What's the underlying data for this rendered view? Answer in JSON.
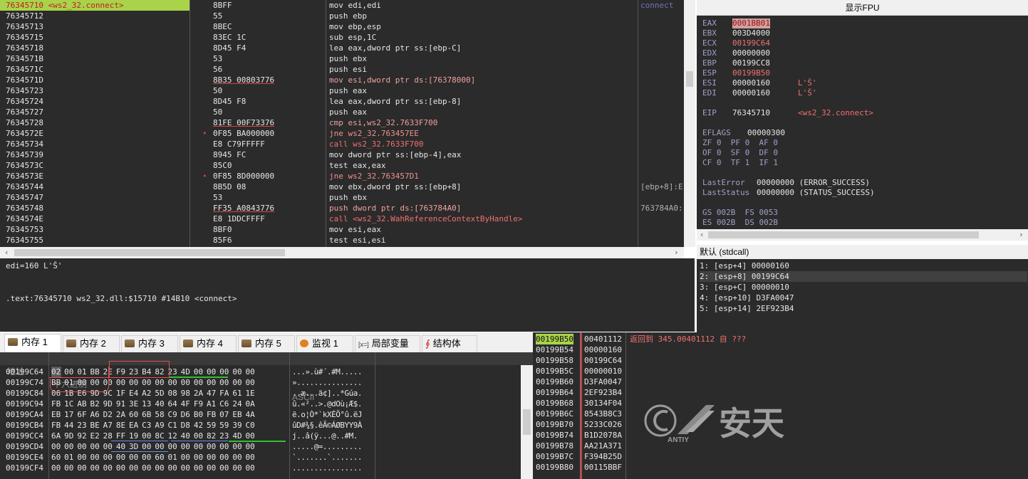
{
  "disasm": {
    "rows": [
      {
        "addr": "76345710 <ws2_32.connect>",
        "mark": "",
        "bytes": "8BFF",
        "instr": "mov edi,edi",
        "cmt": "connect",
        "hl": true
      },
      {
        "addr": "76345712",
        "mark": "",
        "bytes": "55",
        "instr": "push ebp",
        "cmt": ""
      },
      {
        "addr": "76345713",
        "mark": "",
        "bytes": "8BEC",
        "instr": "mov ebp,esp",
        "cmt": ""
      },
      {
        "addr": "76345715",
        "mark": "",
        "bytes": "83EC 1C",
        "instr": "sub esp,1C",
        "cmt": ""
      },
      {
        "addr": "76345718",
        "mark": "",
        "bytes": "8D45 F4",
        "instr": "lea eax,dword ptr ss:[ebp-C]",
        "cmt": ""
      },
      {
        "addr": "7634571B",
        "mark": "",
        "bytes": "53",
        "instr": "push ebx",
        "cmt": ""
      },
      {
        "addr": "7634571C",
        "mark": "",
        "bytes": "56",
        "instr": "push esi",
        "cmt": ""
      },
      {
        "addr": "7634571D",
        "mark": "",
        "bytes": "8B35 00803776",
        "instr": "mov esi,dword ptr ds:[76378000]",
        "cmt": ""
      },
      {
        "addr": "76345723",
        "mark": "",
        "bytes": "50",
        "instr": "push eax",
        "cmt": ""
      },
      {
        "addr": "76345724",
        "mark": "",
        "bytes": "8D45 F8",
        "instr": "lea eax,dword ptr ss:[ebp-8]",
        "cmt": ""
      },
      {
        "addr": "76345727",
        "mark": "",
        "bytes": "50",
        "instr": "push eax",
        "cmt": ""
      },
      {
        "addr": "76345728",
        "mark": "",
        "bytes": "81FE 00F73376",
        "instr": "cmp esi,ws2_32.7633F700",
        "cmt": ""
      },
      {
        "addr": "7634572E",
        "mark": "•",
        "bytes": "0F85 BA000000",
        "instr": "jne ws2_32.763457EE",
        "cmt": ""
      },
      {
        "addr": "76345734",
        "mark": "",
        "bytes": "E8 C79FFFFF",
        "instr": "call ws2_32.7633F700",
        "cmt": ""
      },
      {
        "addr": "76345739",
        "mark": "",
        "bytes": "8945 FC",
        "instr": "mov dword ptr ss:[ebp-4],eax",
        "cmt": ""
      },
      {
        "addr": "7634573C",
        "mark": "",
        "bytes": "85C0",
        "instr": "test eax,eax",
        "cmt": ""
      },
      {
        "addr": "7634573E",
        "mark": "•",
        "bytes": "0F85 8D000000",
        "instr": "jne ws2_32.763457D1",
        "cmt": ""
      },
      {
        "addr": "76345744",
        "mark": "",
        "bytes": "8B5D 08",
        "instr": "mov ebx,dword ptr ss:[ebp+8]",
        "cmt": "[ebp+8]:E"
      },
      {
        "addr": "76345747",
        "mark": "",
        "bytes": "53",
        "instr": "push ebx",
        "cmt": ""
      },
      {
        "addr": "76345748",
        "mark": "",
        "bytes": "FF35 A0843776",
        "instr": "push dword ptr ds:[763784A0]",
        "cmt": "763784A0:"
      },
      {
        "addr": "7634574E",
        "mark": "",
        "bytes": "E8 1DDCFFFF",
        "instr": "call <ws2_32.WahReferenceContextByHandle>",
        "cmt": ""
      },
      {
        "addr": "76345753",
        "mark": "",
        "bytes": "8BF0",
        "instr": "mov esi,eax",
        "cmt": ""
      },
      {
        "addr": "76345755",
        "mark": "",
        "bytes": "85F6",
        "instr": "test esi,esi",
        "cmt": ""
      }
    ]
  },
  "info": {
    "line1": "edi=160 L'Š'",
    "line2": ".text:76345710 ws2_32.dll:$15710 #14B10 <connect>"
  },
  "registers": {
    "header": "显示FPU",
    "lines": [
      {
        "name": "EAX",
        "val": "0001BB01",
        "extra": "",
        "style": "sel"
      },
      {
        "name": "EBX",
        "val": "003D4000",
        "extra": "",
        "style": ""
      },
      {
        "name": "ECX",
        "val": "00199C64",
        "extra": "",
        "style": "red"
      },
      {
        "name": "EDX",
        "val": "00000000",
        "extra": "",
        "style": ""
      },
      {
        "name": "EBP",
        "val": "00199CC8",
        "extra": "",
        "style": ""
      },
      {
        "name": "ESP",
        "val": "00199B50",
        "extra": "",
        "style": "red"
      },
      {
        "name": "ESI",
        "val": "00000160",
        "extra": "L'Š'",
        "style": ""
      },
      {
        "name": "EDI",
        "val": "00000160",
        "extra": "L'Š'",
        "style": ""
      },
      {
        "name": "",
        "val": "",
        "extra": "",
        "style": ""
      },
      {
        "name": "EIP",
        "val": "76345710",
        "extra": "<ws2_32.connect>",
        "style": ""
      },
      {
        "name": "",
        "val": "",
        "extra": "",
        "style": ""
      },
      {
        "name": "EFLAGS",
        "val": "00000300",
        "extra": "",
        "style": ""
      },
      {
        "name": "ZF 0  PF 0  AF 0",
        "val": "",
        "extra": "",
        "style": ""
      },
      {
        "name": "OF 0  SF 0  DF 0",
        "val": "",
        "extra": "",
        "style": ""
      },
      {
        "name": "CF 0  TF 1  IF 1",
        "val": "",
        "extra": "",
        "style": ""
      },
      {
        "name": "",
        "val": "",
        "extra": "",
        "style": ""
      },
      {
        "name": "LastError",
        "val": "00000000 (ERROR_SUCCESS)",
        "extra": "",
        "style": ""
      },
      {
        "name": "LastStatus",
        "val": "00000000 (STATUS_SUCCESS)",
        "extra": "",
        "style": ""
      },
      {
        "name": "",
        "val": "",
        "extra": "",
        "style": ""
      },
      {
        "name": "GS 002B  FS 0053",
        "val": "",
        "extra": "",
        "style": ""
      },
      {
        "name": "ES 002B  DS 002B",
        "val": "",
        "extra": "",
        "style": ""
      }
    ]
  },
  "args": {
    "header": "默认 (stdcall)",
    "rows": [
      "1: [esp+4] 00000160",
      "2: [esp+8] 00199C64",
      "3: [esp+C] 00000010",
      "4: [esp+10] D3FA0047",
      "5: [esp+14] 2EF923B4"
    ]
  },
  "tabs": [
    {
      "label": "内存 1",
      "active": true
    },
    {
      "label": "内存 2"
    },
    {
      "label": "内存 3"
    },
    {
      "label": "内存 4"
    },
    {
      "label": "内存 5"
    },
    {
      "label": "监视 1"
    },
    {
      "label": "局部变量",
      "prefix": "[x=]"
    },
    {
      "label": "结构体"
    }
  ],
  "dump": {
    "col_addr": "地址",
    "col_hex": "十六进制",
    "col_ascii": "ASCII",
    "rows": [
      {
        "addr": "00199C64",
        "hex": "02 00 01 BB 2E F9 23 B4 82 23 4D 00 00 00 00 00",
        "ascii": "...».ù#´.#M....."
      },
      {
        "addr": "00199C74",
        "hex": "BB 01 00 00 00 00 00 00 00 00 00 00 00 00 00 00",
        "ascii": "»..............."
      },
      {
        "addr": "00199C84",
        "hex": "06 1B E6 9D 9C 1F E4 A2 5D 08 98 2A 47 FA 61 1E",
        "ascii": "..æ...ä¢]..*Gúa."
      },
      {
        "addr": "00199C94",
        "hex": "FB 1C AB B2 9D 91 3E 13 40 64 4F F9 A1 C6 24 0A",
        "ascii": "û.«²..>.@dOù¡Æ$."
      },
      {
        "addr": "00199CA4",
        "hex": "EB 17 6F A6 D2 2A 60 6B 58 C9 D6 B0 FB 07 EB 4A",
        "ascii": "ë.o¦Ò*`kXÉÖ°û.ëJ"
      },
      {
        "addr": "00199CB4",
        "hex": "FB 44 23 BE A7 8E EA C3 A9 C1 D8 42 59 59 39 C0",
        "ascii": "ûD#¾§.êÃ©ÁØBYY9À"
      },
      {
        "addr": "00199CC4",
        "hex": "6A 9D 92 E2 28 FF 19 00 8C 12 40 00 82 23 4D 00",
        "ascii": "j..â(ÿ...@..#M."
      },
      {
        "addr": "00199CD4",
        "hex": "00 00 00 00 00 40 3D 00 00 00 00 00 00 00 00 00",
        "ascii": ".....@=........."
      },
      {
        "addr": "00199CE4",
        "hex": "60 01 00 00 00 00 00 00 60 01 00 00 00 00 00 00",
        "ascii": "`.......`......."
      },
      {
        "addr": "00199CF4",
        "hex": "00 00 00 00 00 00 00 00 00 00 00 00 00 00 00 00",
        "ascii": "................"
      }
    ]
  },
  "stack": {
    "rows": [
      {
        "addr": "00199B50",
        "val": "00401112",
        "cmt": "返回到 345.00401112 自 ???",
        "hl": true
      },
      {
        "addr": "00199B54",
        "val": "00000160",
        "cmt": ""
      },
      {
        "addr": "00199B58",
        "val": "00199C64",
        "cmt": ""
      },
      {
        "addr": "00199B5C",
        "val": "00000010",
        "cmt": ""
      },
      {
        "addr": "00199B60",
        "val": "D3FA0047",
        "cmt": ""
      },
      {
        "addr": "00199B64",
        "val": "2EF923B4",
        "cmt": ""
      },
      {
        "addr": "00199B68",
        "val": "30134F04",
        "cmt": ""
      },
      {
        "addr": "00199B6C",
        "val": "8543B8C3",
        "cmt": ""
      },
      {
        "addr": "00199B70",
        "val": "5233C026",
        "cmt": ""
      },
      {
        "addr": "00199B74",
        "val": "B1D2078A",
        "cmt": ""
      },
      {
        "addr": "00199B78",
        "val": "AA21A371",
        "cmt": ""
      },
      {
        "addr": "00199B7C",
        "val": "F394B25D",
        "cmt": ""
      },
      {
        "addr": "00199B80",
        "val": "00115BBF",
        "cmt": ""
      }
    ],
    "watermark": "安天",
    "watermark_sub": "ANTIY"
  }
}
